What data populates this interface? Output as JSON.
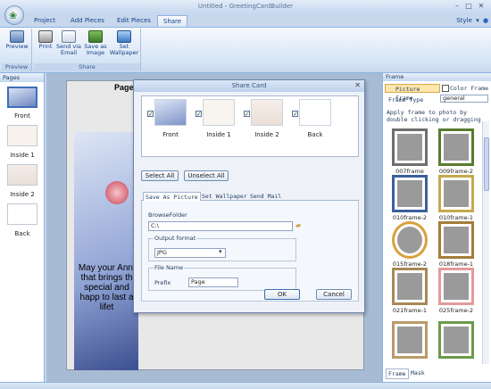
{
  "window": {
    "title": "Untitled - GreetingCardBuilder",
    "minimize": "–",
    "maximize": "□",
    "close": "✕"
  },
  "ribbon": {
    "tabs": [
      "Project",
      "Add Pieces",
      "Edit Pieces",
      "Share"
    ],
    "active_tab": "Share",
    "style_label": "Style",
    "groups": [
      {
        "label": "Preview",
        "buttons": [
          "Preview"
        ]
      },
      {
        "label": "Share",
        "buttons": [
          "Print",
          "Send via Email",
          "Save as Image",
          "Set Wallpaper"
        ]
      }
    ],
    "button_lines": {
      "preview": [
        "Preview"
      ],
      "print": [
        "Print"
      ],
      "email": [
        "Send via",
        "Email"
      ],
      "saveimg": [
        "Save as",
        "Image"
      ],
      "wallpaper": [
        "Set",
        "Wallpaper"
      ]
    }
  },
  "pages_panel": {
    "header": "Pages",
    "pages": [
      "Front",
      "Inside 1",
      "Inside 2",
      "Back"
    ]
  },
  "canvas": {
    "page_label": "Page:",
    "card_text": "May your Anni that brings th special and happ to last a lifet"
  },
  "dialog": {
    "title": "Share Card",
    "thumbs": [
      "Front",
      "Inside 1",
      "Inside 2",
      "Back"
    ],
    "checkmark": "✓",
    "select_all": "Select All",
    "unselect_all": "Unselect All",
    "tabs": [
      "Save As Picture",
      "Set Wallpaper",
      "Send Mail"
    ],
    "active_tab": "Save As Picture",
    "browse_folder_label": "BrowseFolder",
    "browse_folder_value": "C:\\",
    "output_format_label": "Output format",
    "output_format_value": "JPG",
    "file_name_label": "File Name",
    "prefix_label": "Prefix",
    "prefix_value": "Page",
    "ok": "OK",
    "cancel": "Cancel"
  },
  "frame_panel": {
    "header": "Frame",
    "tab_picture": "Picture Frame",
    "tab_color": "Color Frame",
    "frame_type_label": "Frame Type",
    "frame_type_value": "general",
    "hint": "Apply frame to photo by double clicking or dragging",
    "items": [
      "007frame",
      "009frame-2",
      "010frame-2",
      "010frame-1",
      "015frame-2",
      "018frame-1",
      "021frame-1",
      "025frame-2",
      "",
      ""
    ],
    "bottom_tabs": [
      "Frame",
      "Mask"
    ]
  }
}
